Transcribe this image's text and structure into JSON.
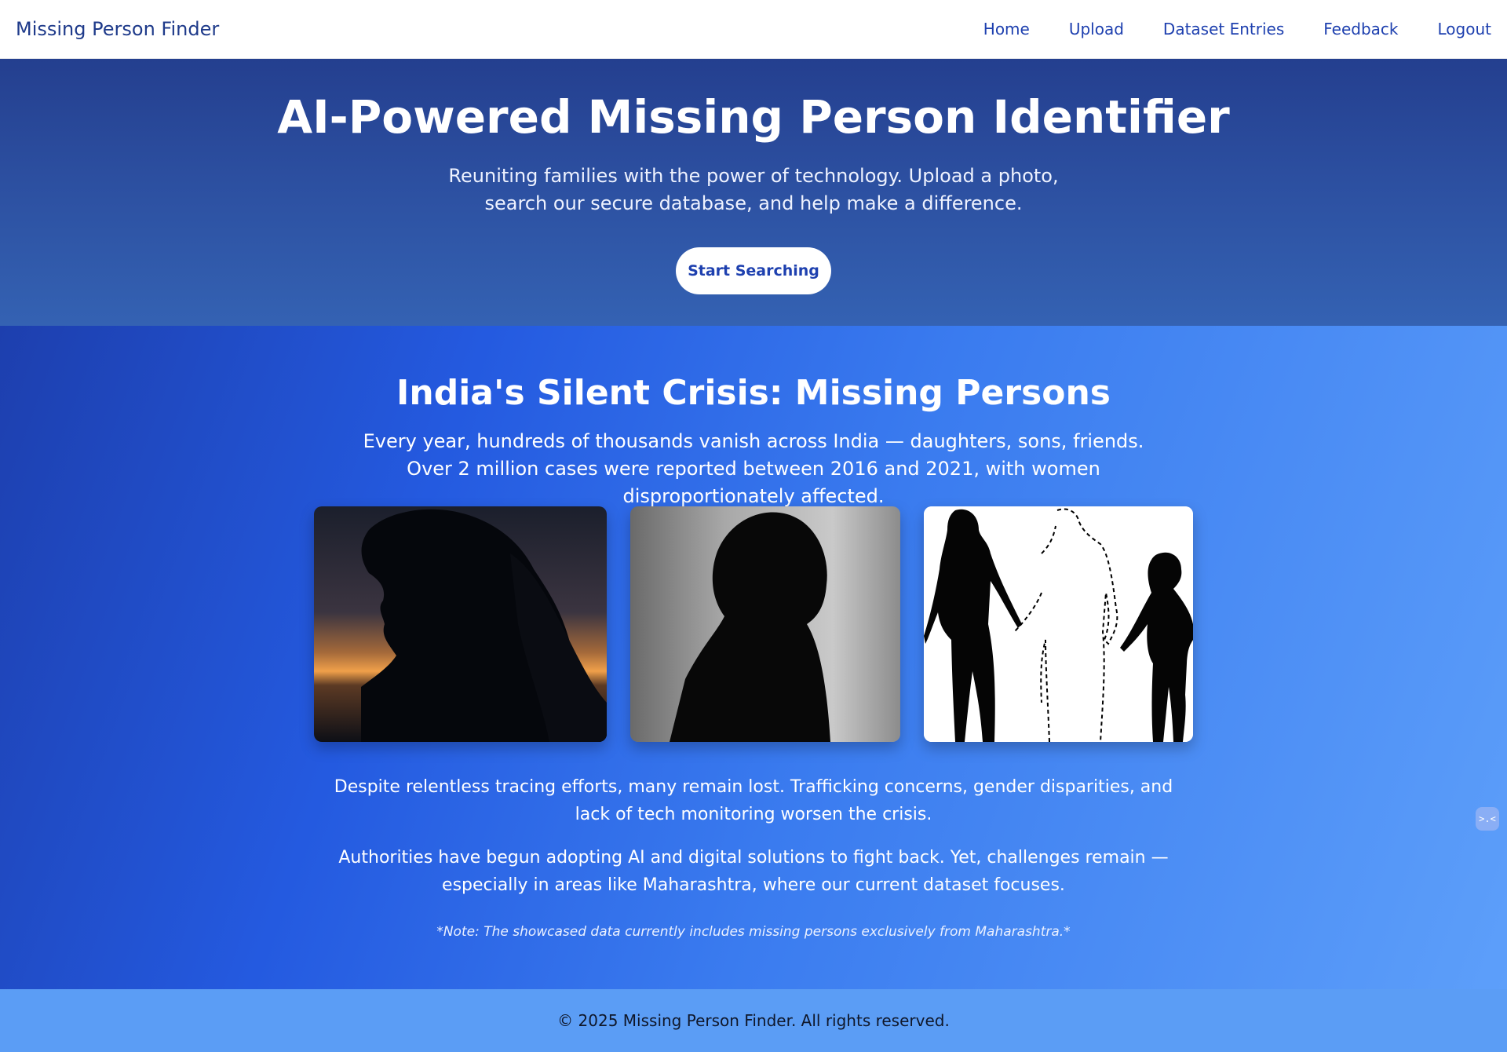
{
  "nav": {
    "brand": "Missing Person Finder",
    "links": [
      "Home",
      "Upload",
      "Dataset Entries",
      "Feedback",
      "Logout"
    ]
  },
  "hero": {
    "title": "AI-Powered Missing Person Identifier",
    "subtitle": "Reuniting families with the power of technology. Upload a photo, search our secure database, and help make a difference.",
    "button": "Start Searching"
  },
  "crisis": {
    "title": "India's Silent Crisis: Missing Persons",
    "intro": "Every year, hundreds of thousands vanish across India — daughters, sons, friends. Over 2 million cases were reported between 2016 and 2021, with women disproportionately affected.",
    "images": [
      {
        "icon": "woman-silhouette-sunset-image"
      },
      {
        "icon": "boy-silhouette-image"
      },
      {
        "icon": "family-missing-member-image"
      }
    ],
    "paragraph2": "Despite relentless tracing efforts, many remain lost. Trafficking concerns, gender disparities, and lack of tech monitoring worsen the crisis.",
    "paragraph3": "Authorities have begun adopting AI and digital solutions to fight back. Yet, challenges remain — especially in areas like Maharashtra, where our current dataset focuses.",
    "note": "*Note: The showcased data currently includes missing persons exclusively from Maharashtra.*"
  },
  "footer": {
    "text": "© 2025 Missing Person Finder. All rights reserved."
  },
  "widget": {
    "icon": "assistant-face-icon",
    "glyph": ">.<"
  },
  "colors": {
    "brand": "#1e3a8a",
    "hero_bg": "#2c4fa0",
    "crisis_bg_start": "#1d3fae",
    "crisis_bg_end": "#5d9ffa",
    "footer_bg": "#5b9df5"
  }
}
